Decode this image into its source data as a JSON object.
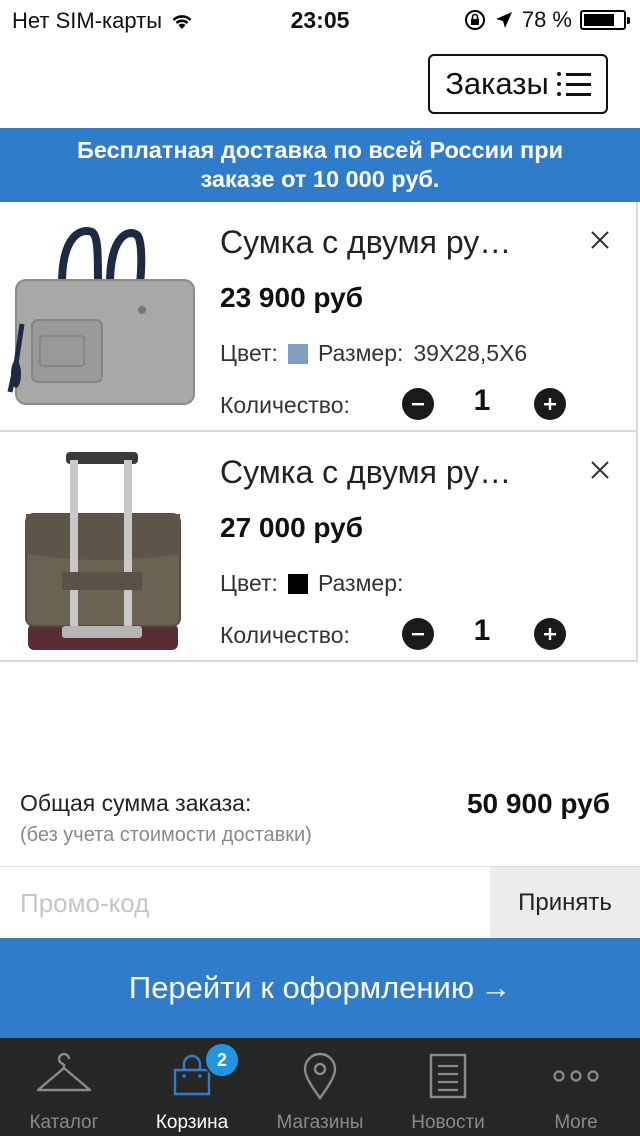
{
  "status_bar": {
    "carrier": "Нет SIM-карты",
    "time": "23:05",
    "battery": "78 %",
    "battery_level": 0.78
  },
  "header": {
    "orders_label": "Заказы"
  },
  "banner": {
    "line1": "Бесплатная доставка по всей России при",
    "line2": "заказе от 10 000 руб."
  },
  "cart": {
    "items": [
      {
        "name": "Сумка с двумя ру…",
        "price": "23 900 руб",
        "color_label": "Цвет:",
        "color_hex": "#7f9ec2",
        "size_label": "Размер:",
        "size_value": "39X28,5X6",
        "qty_label": "Количество:",
        "qty": "1"
      },
      {
        "name": "Сумка с двумя ру…",
        "price": "27 000 руб",
        "color_label": "Цвет:",
        "color_hex": "#000000",
        "size_label": "Размер:",
        "size_value": "",
        "qty_label": "Количество:",
        "qty": "1"
      }
    ]
  },
  "total": {
    "label": "Общая сумма заказа:",
    "note": "(без учета стоимости доставки)",
    "value": "50 900 руб"
  },
  "promo": {
    "placeholder": "Промо-код",
    "apply_label": "Принять"
  },
  "checkout": {
    "label": "Перейти к оформлению",
    "arrow": "→"
  },
  "tabbar": {
    "tabs": [
      {
        "label": "Каталог",
        "icon": "hanger-icon"
      },
      {
        "label": "Корзина",
        "icon": "bag-icon",
        "badge": "2"
      },
      {
        "label": "Магазины",
        "icon": "map-pin-icon"
      },
      {
        "label": "Новости",
        "icon": "news-icon"
      },
      {
        "label": "More",
        "icon": "more-icon"
      }
    ],
    "active_index": 1
  },
  "colors": {
    "accent": "#2f7ccb",
    "tabbar_bg": "#262626",
    "badge": "#2196e0"
  }
}
